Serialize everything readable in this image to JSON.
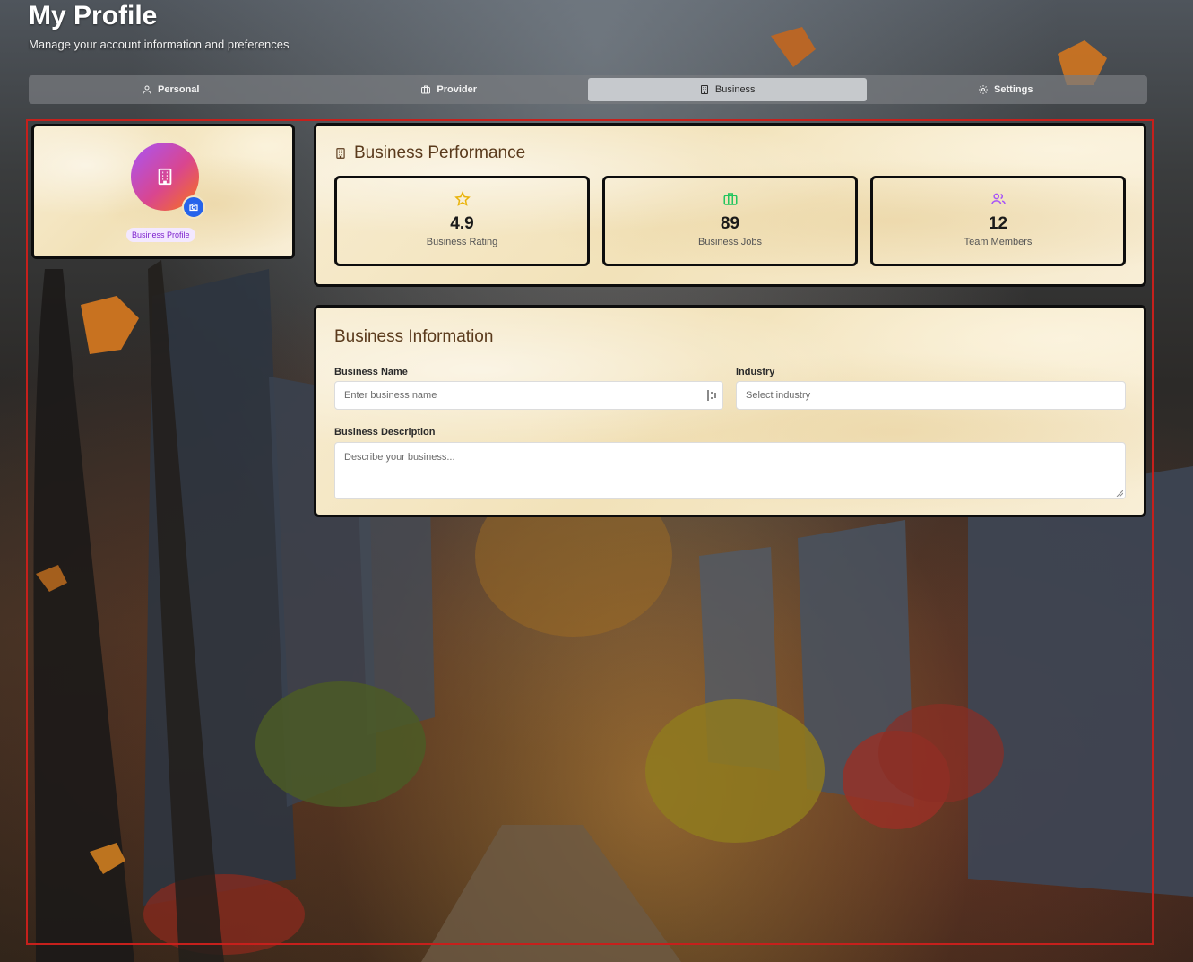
{
  "header": {
    "title": "My Profile",
    "subtitle": "Manage your account information and preferences"
  },
  "tabs": [
    {
      "label": "Personal",
      "icon": "user-icon",
      "active": false
    },
    {
      "label": "Provider",
      "icon": "briefcase-icon",
      "active": false
    },
    {
      "label": "Business",
      "icon": "building-icon",
      "active": true
    },
    {
      "label": "Settings",
      "icon": "gear-icon",
      "active": false
    }
  ],
  "profile": {
    "avatar_icon": "building-icon",
    "camera_icon": "camera-icon",
    "badge": "Business Profile"
  },
  "performance": {
    "title": "Business Performance",
    "stats": [
      {
        "value": "4.9",
        "label": "Business Rating",
        "icon": "star-icon",
        "color": "#eab308"
      },
      {
        "value": "89",
        "label": "Business Jobs",
        "icon": "briefcase-icon",
        "color": "#22c55e"
      },
      {
        "value": "12",
        "label": "Team Members",
        "icon": "users-icon",
        "color": "#a855f7"
      }
    ]
  },
  "business_info": {
    "title": "Business Information",
    "name": {
      "label": "Business Name",
      "placeholder": "Enter business name",
      "value": ""
    },
    "industry": {
      "label": "Industry",
      "placeholder": "Select industry",
      "value": ""
    },
    "description": {
      "label": "Business Description",
      "placeholder": "Describe your business...",
      "value": ""
    }
  },
  "colors": {
    "accent": "#2563eb",
    "avatar_gradient_start": "#a855f7",
    "avatar_gradient_end": "#f97316",
    "highlight_frame": "#c6201c",
    "card_title": "#5a3a1c"
  }
}
